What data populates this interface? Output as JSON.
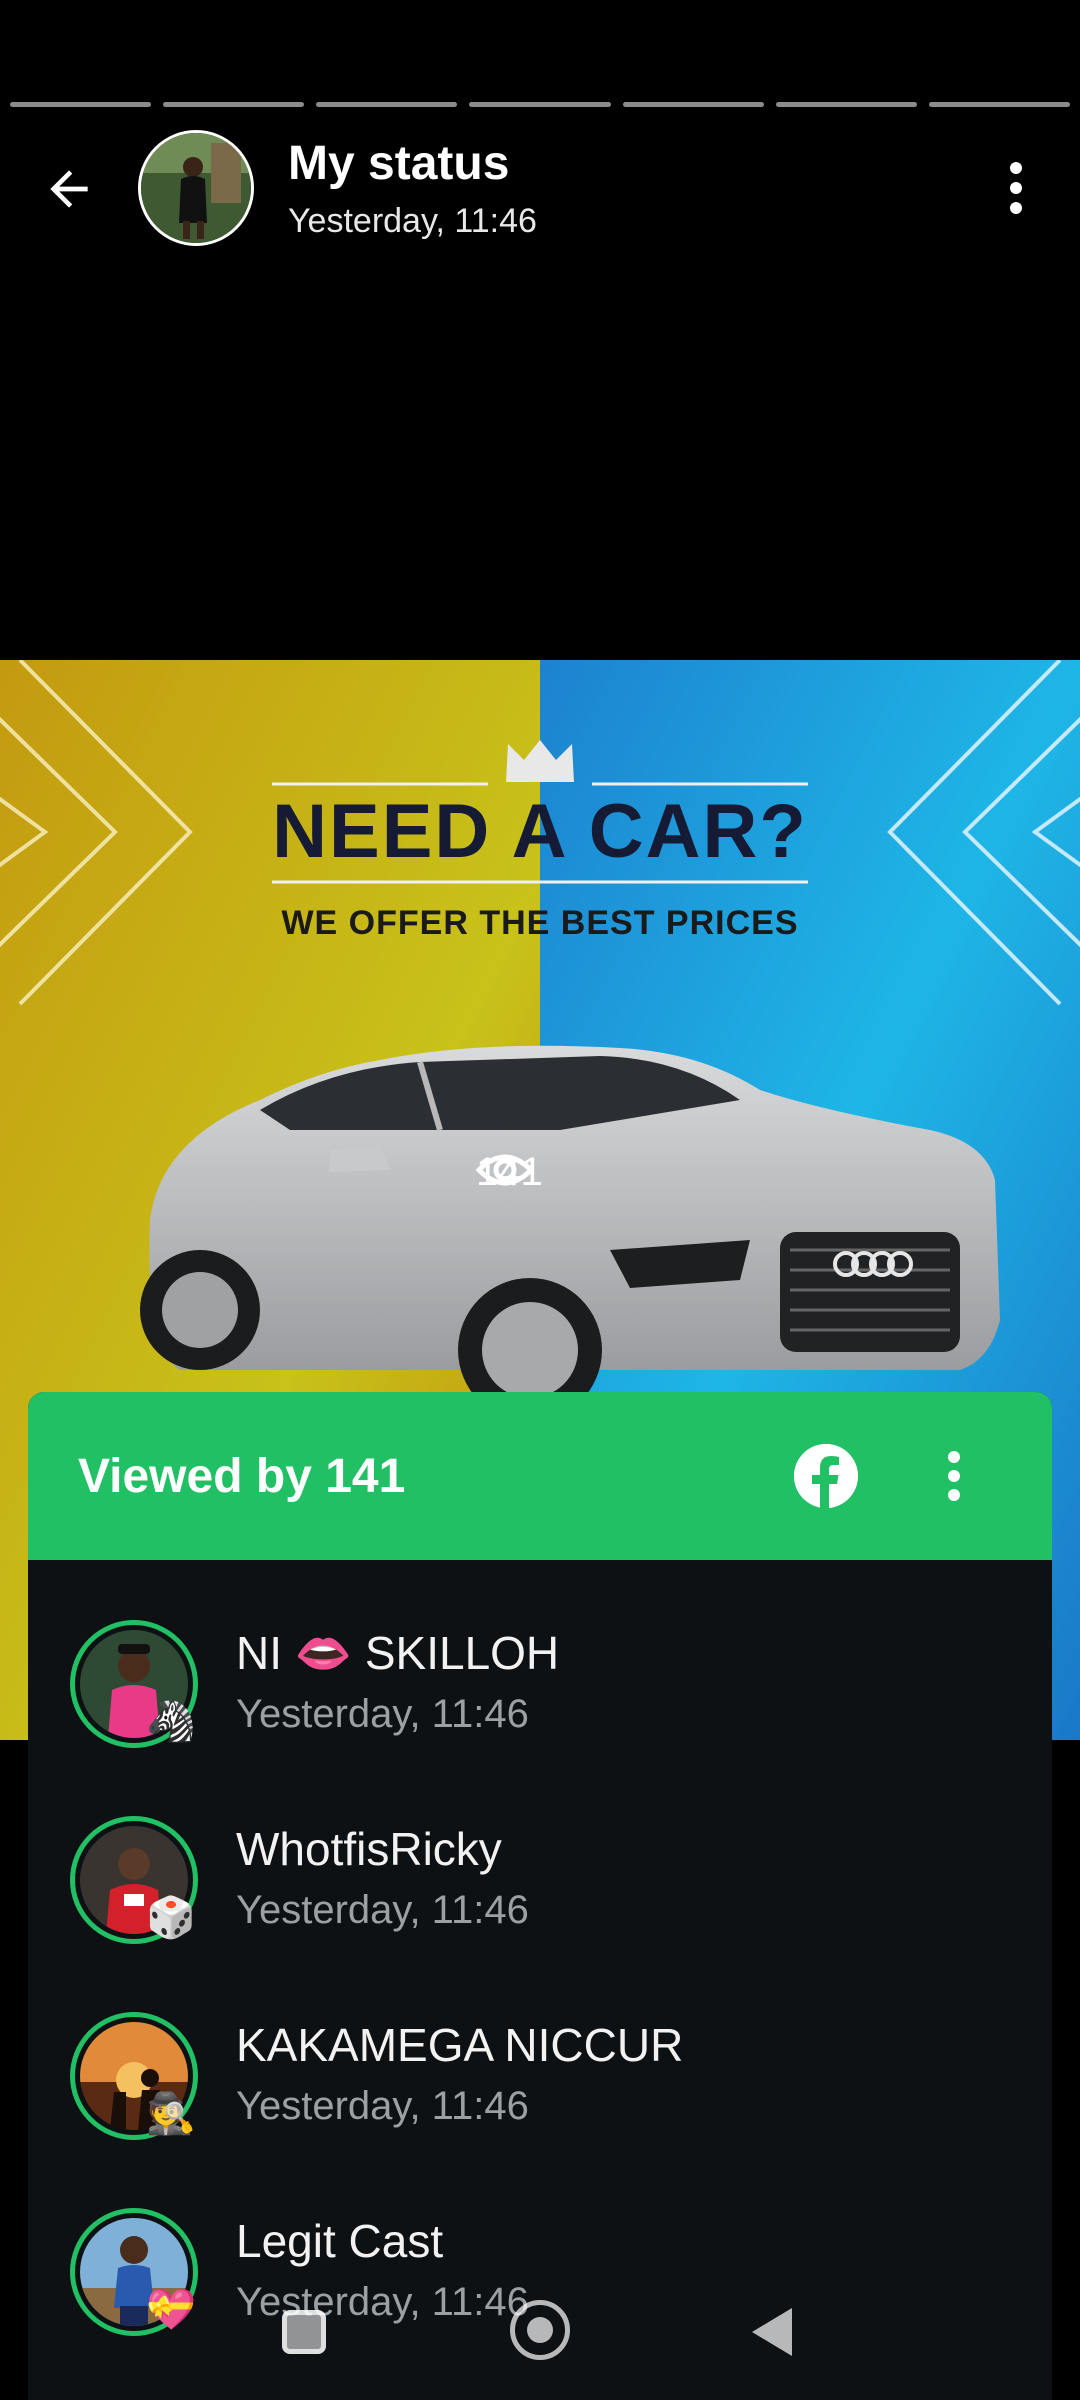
{
  "header": {
    "title": "My status",
    "subtitle": "Yesterday, 11:46",
    "progress_segments": 7
  },
  "status_image": {
    "headline": "NEED A CAR?",
    "subline": "WE OFFER THE BEST PRICES",
    "view_count": "141",
    "colors": {
      "left": "#c9a20c",
      "right": "#1f8fd8",
      "headline": "#151a35"
    }
  },
  "sheet": {
    "title": "Viewed by 141",
    "accent_color": "#22c064",
    "viewers": [
      {
        "name": "NI 👄 SKILLOH",
        "time": "Yesterday, 11:46",
        "emoji": "🦓"
      },
      {
        "name": "WhotfisRicky",
        "time": "Yesterday, 11:46",
        "emoji": "🎲"
      },
      {
        "name": "KAKAMEGA NICCUR",
        "time": "Yesterday, 11:46",
        "emoji": "🕵"
      },
      {
        "name": "Legit Cast",
        "time": "Yesterday, 11:46",
        "emoji": "💝"
      }
    ]
  },
  "icons": {
    "back": "arrow-left-icon",
    "menu": "more-vert-icon",
    "facebook": "facebook-icon",
    "views": "eye-icon"
  }
}
